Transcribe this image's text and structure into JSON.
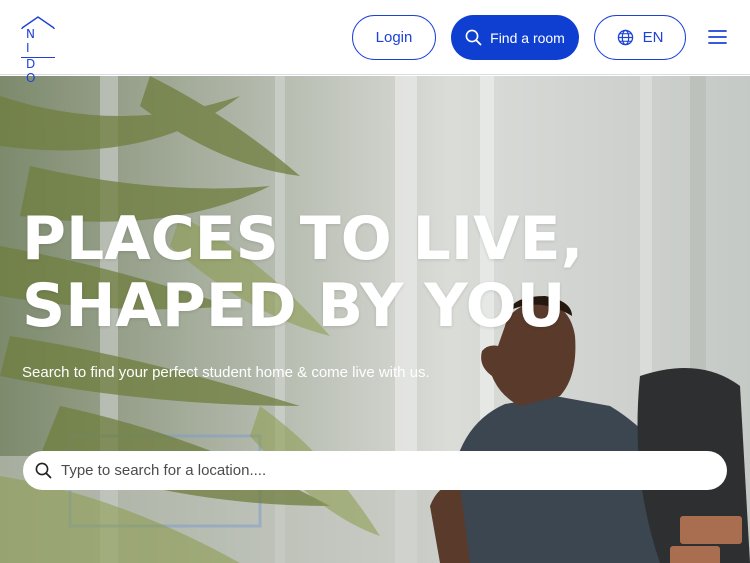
{
  "header": {
    "logo_text_top": "N I",
    "logo_text_bottom": "D O",
    "login_label": "Login",
    "find_room_label": "Find a room",
    "language_label": "EN"
  },
  "hero": {
    "title_line1": "PLACES TO LIVE,",
    "title_line2": "SHAPED BY YOU",
    "subtitle": "Search to find your perfect student home & come live with us.",
    "search_placeholder": "Type to search for a location...."
  },
  "colors": {
    "brand_blue": "#1d42d6",
    "button_blue": "#0f3fd1"
  },
  "icons": [
    "house-roof-icon",
    "search-icon",
    "globe-icon",
    "hamburger-menu-icon"
  ]
}
